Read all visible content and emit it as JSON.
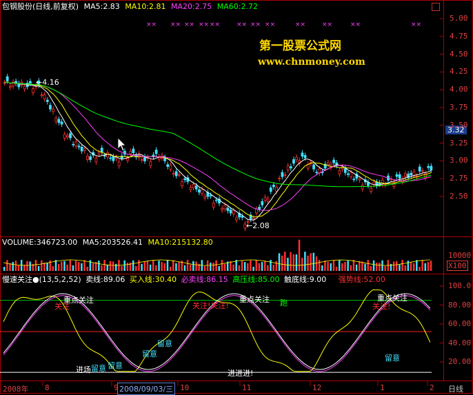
{
  "price_panel": {
    "stock_name": "包钢股份",
    "period_label": "(日线,前复权)",
    "ma_items": [
      {
        "label": "MA5:2.83",
        "color": "#ffffff"
      },
      {
        "label": "MA10:2.81",
        "color": "#ffff00"
      },
      {
        "label": "MA20:2.75",
        "color": "#ff40ff"
      },
      {
        "label": "MA60:2.72",
        "color": "#00ff00"
      }
    ],
    "high_marker": "4.16",
    "low_marker": "2.08",
    "current_price": "3.32",
    "y_labels": [
      "5.00",
      "4.75",
      "4.50",
      "4.25",
      "4.00",
      "3.75",
      "3.50",
      "3.25",
      "3.00",
      "2.75",
      "2.50"
    ],
    "watermark": {
      "title": "第一股票公式网",
      "url": "www.chnmoney.com"
    },
    "marks": [
      "××",
      "××",
      "××",
      "××",
      "××",
      "××",
      "××",
      "××",
      "××",
      "××",
      "××",
      "××"
    ]
  },
  "volume_panel": {
    "volume": "VOLUME:346723.00",
    "ma5": "MA5:203526.41",
    "ma10": "MA10:215132.80",
    "y_label": "10000",
    "unit": "X100"
  },
  "indicator_panel": {
    "name": "慢速关注●",
    "params": "(13,5,2,52)",
    "sell": "卖线:89.06",
    "buy": "买入线:30.40",
    "must_sell": "必卖线:86.15",
    "high_pressure": "高压线:85.00",
    "bottom": "触底线:9.00",
    "strong": "强势线:52.00",
    "y_labels": [
      "100.0",
      "80.00",
      "60.00",
      "40.00",
      "20.00"
    ],
    "annotations": [
      {
        "text": "重点关注",
        "color": "#ffffff"
      },
      {
        "text": "关注",
        "color": "#ff3030"
      },
      {
        "text": "进场",
        "color": "#ffffff"
      },
      {
        "text": "留意",
        "color": "#40e0ff"
      },
      {
        "text": "留意",
        "color": "#40e0ff"
      },
      {
        "text": "留意",
        "color": "#40e0ff"
      },
      {
        "text": "留意",
        "color": "#40e0ff"
      },
      {
        "text": "关注!关注!",
        "color": "#ff3030"
      },
      {
        "text": "重点关注",
        "color": "#ffffff"
      },
      {
        "text": "跑",
        "color": "#00ff00"
      },
      {
        "text": "进进进!",
        "color": "#ffffff"
      },
      {
        "text": "重点关注",
        "color": "#ffffff"
      },
      {
        "text": "关注!",
        "color": "#ff3030"
      },
      {
        "text": "留意",
        "color": "#40e0ff"
      }
    ]
  },
  "time_axis": {
    "year": "2008年",
    "labels": [
      "8",
      "9",
      "10",
      "11",
      "12",
      "1",
      "2"
    ],
    "cursor_date": "2008/09/03/三",
    "period_button": "日线"
  },
  "colors": {
    "panel_border": "#b00000",
    "axis_text": "#e04040",
    "up_candle": "#ff3030",
    "down_candle": "#40e0ff"
  }
}
